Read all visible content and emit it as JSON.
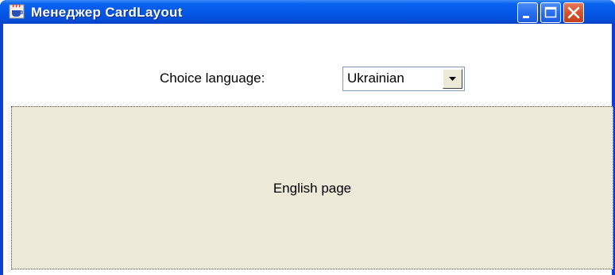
{
  "window": {
    "title": "Менеджер CardLayout",
    "app_icon": "java-cup-icon"
  },
  "titlebar_buttons": [
    "minimize-icon",
    "maximize-icon",
    "close-icon"
  ],
  "language_row": {
    "label": "Choice language:",
    "selected": "Ukrainian"
  },
  "card": {
    "text": "English page"
  },
  "colors": {
    "titlebar": "#0558e8",
    "panel": "#ece9d8",
    "close_button": "#d6532c"
  }
}
